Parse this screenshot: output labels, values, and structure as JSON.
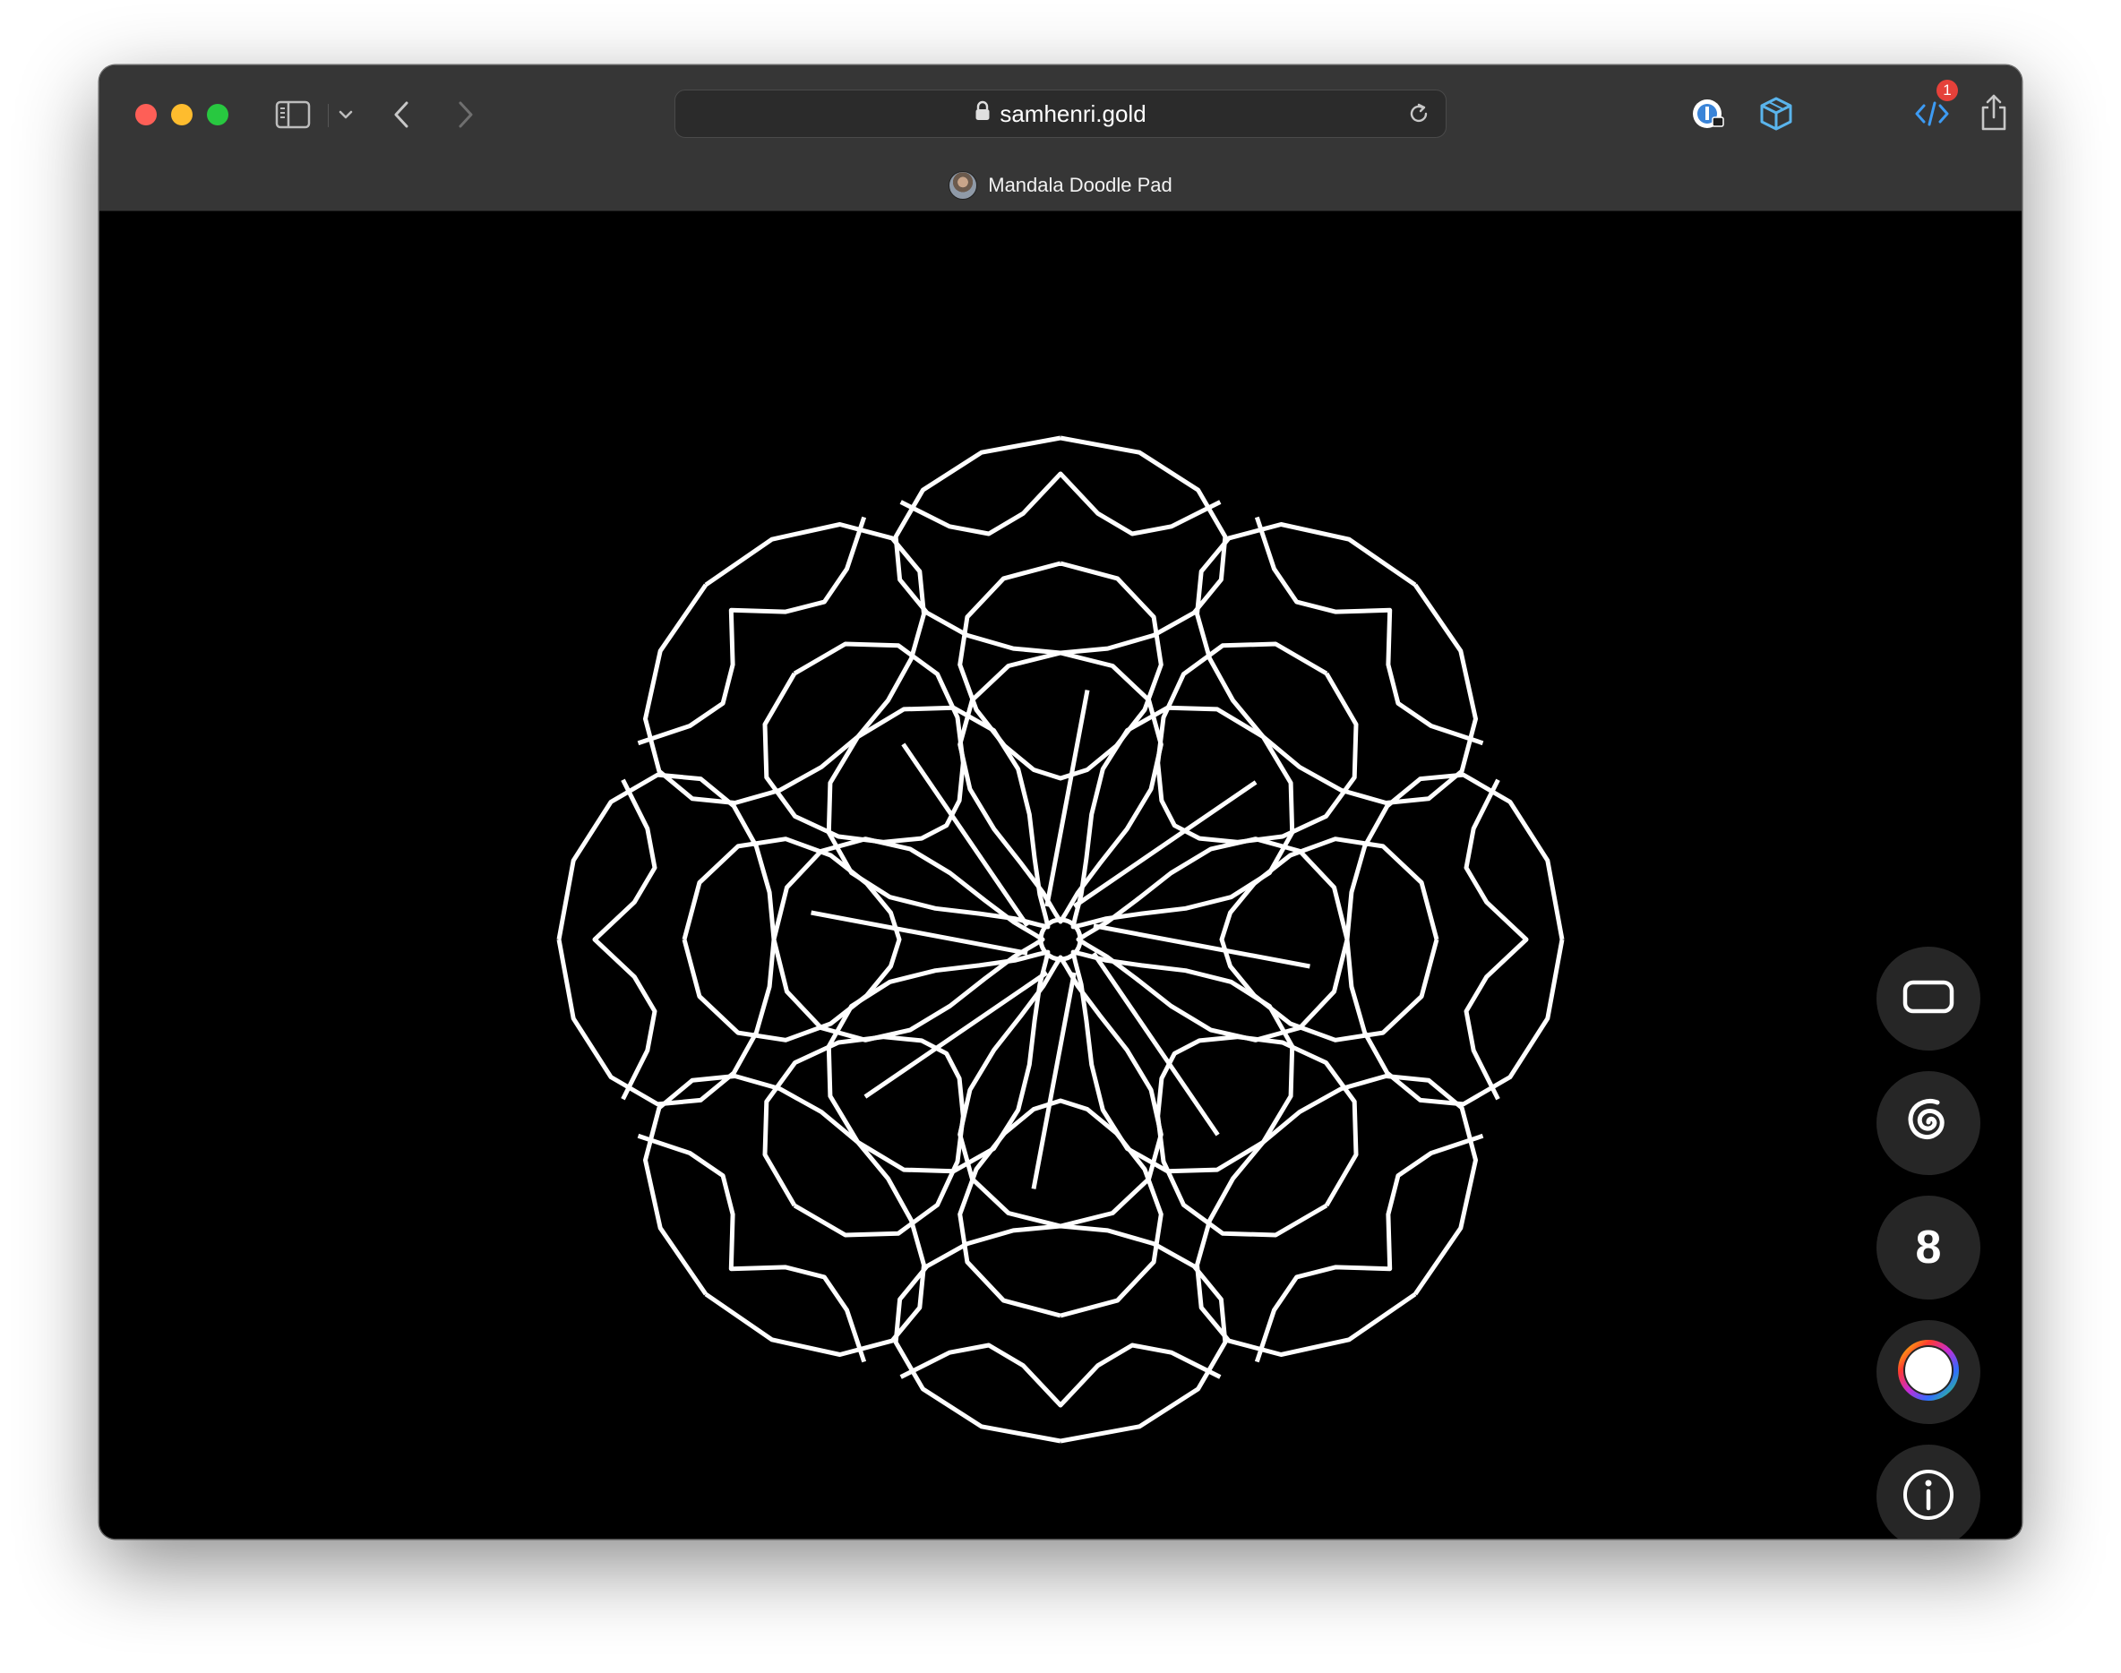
{
  "browser": {
    "url": "samhenri.gold",
    "tab_title": "Mandala Doodle Pad",
    "extension_badge": "1",
    "icons": [
      "sidebar-icon",
      "chevron-down-icon",
      "back-icon",
      "forward-icon",
      "lock-icon",
      "reload-icon",
      "password-extension-icon",
      "cube-extension-icon",
      "code-extension-icon",
      "share-icon",
      "new-tab-icon"
    ]
  },
  "controls": {
    "symmetry_count": "8",
    "buttons": [
      "clear-canvas-button",
      "spiral-mode-button",
      "symmetry-count-button",
      "color-picker-button",
      "info-button"
    ]
  },
  "mandala": {
    "stroke_color": "#ffffff",
    "background_color": "#000000",
    "symmetry": 8
  }
}
